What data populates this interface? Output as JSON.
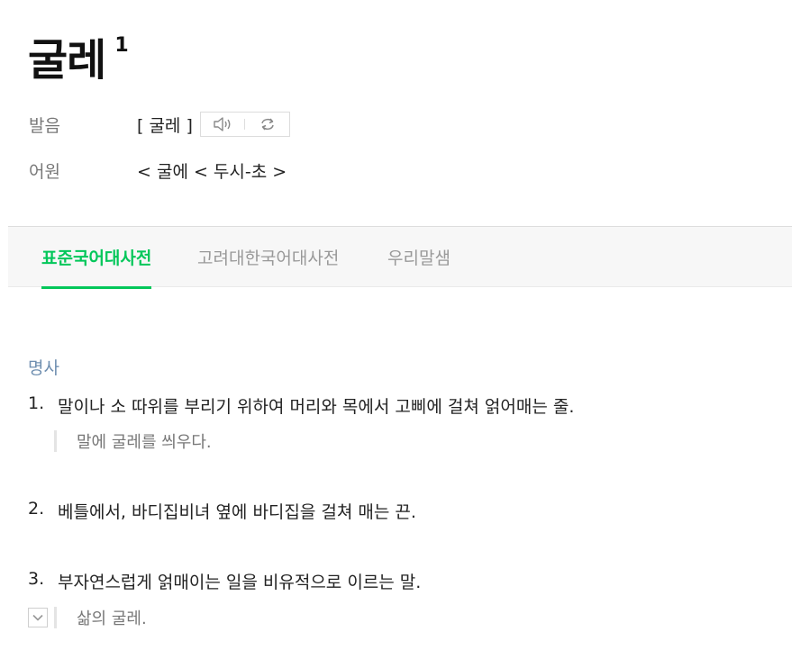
{
  "entry": {
    "headword": "굴레",
    "homonym_number": "1"
  },
  "pronunciation": {
    "label": "발음",
    "value": "[ 굴레 ]",
    "icons": [
      "speaker-icon",
      "repeat-icon"
    ]
  },
  "etymology": {
    "label": "어원",
    "value": "< 굴에 < 두시-초 >"
  },
  "tabs": [
    {
      "label": "표준국어대사전",
      "active": true
    },
    {
      "label": "고려대한국어대사전",
      "active": false
    },
    {
      "label": "우리말샘",
      "active": false
    }
  ],
  "definitions": {
    "part_of_speech": "명사",
    "senses": [
      {
        "num": "1.",
        "text": "말이나 소 따위를 부리기 위하여 머리와 목에서 고삐에 걸쳐 얽어매는 줄.",
        "example": "말에 굴레를 씌우다."
      },
      {
        "num": "2.",
        "text": "베틀에서, 바디집비녀 옆에 바디집을 걸쳐 매는 끈."
      },
      {
        "num": "3.",
        "text": "부자연스럽게 얽매이는 일을 비유적으로 이르는 말.",
        "example": "삶의 굴레."
      }
    ]
  },
  "colors": {
    "accent": "#03c75a",
    "pos_label": "#6f8fb0",
    "muted": "#777777"
  }
}
